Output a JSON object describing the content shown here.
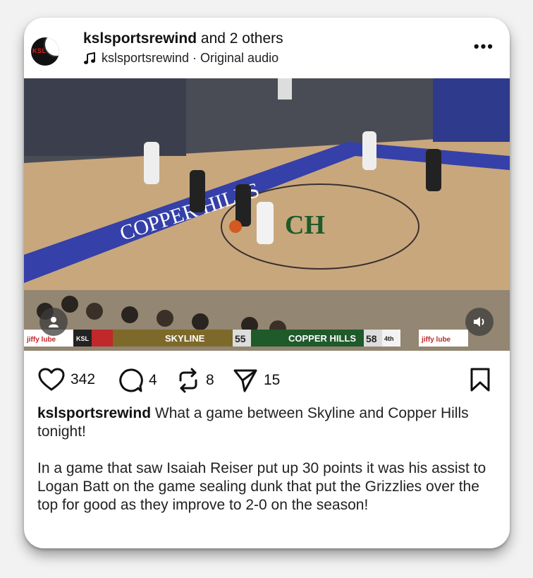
{
  "post": {
    "author": "kslsportsrewind",
    "coauthors": "and 2 others",
    "audio": "kslsportsrewind · Original audio",
    "more_icon": "more-horizontal-icon",
    "avatar_text": "KSL"
  },
  "video": {
    "court_text": "COPPER HILLS",
    "court_logo": "CH",
    "scoreboard": {
      "left_sponsor": "jiffy lube",
      "network": "KSL",
      "team1": "SKYLINE",
      "score1": "55",
      "team2": "COPPER HILLS",
      "score2": "58",
      "period": "4th",
      "right_sponsor": "jiffy lube"
    },
    "colors": {
      "court": "#c9a77d",
      "paint": "#3540a8",
      "scorebar_left": "#7d6a2a",
      "scorebar_right": "#1f5a2a"
    }
  },
  "actions": {
    "likes": "342",
    "comments": "4",
    "reposts": "8",
    "shares": "15"
  },
  "caption": {
    "author": "kslsportsrewind",
    "text1": "What a game between Skyline and Copper Hills tonight!",
    "text2": "In a game that saw Isaiah Reiser put up 30 points it was his assist to Logan Batt on the game sealing dunk that put the Grizzlies over the top for good as they improve to 2-0 on the season!"
  }
}
